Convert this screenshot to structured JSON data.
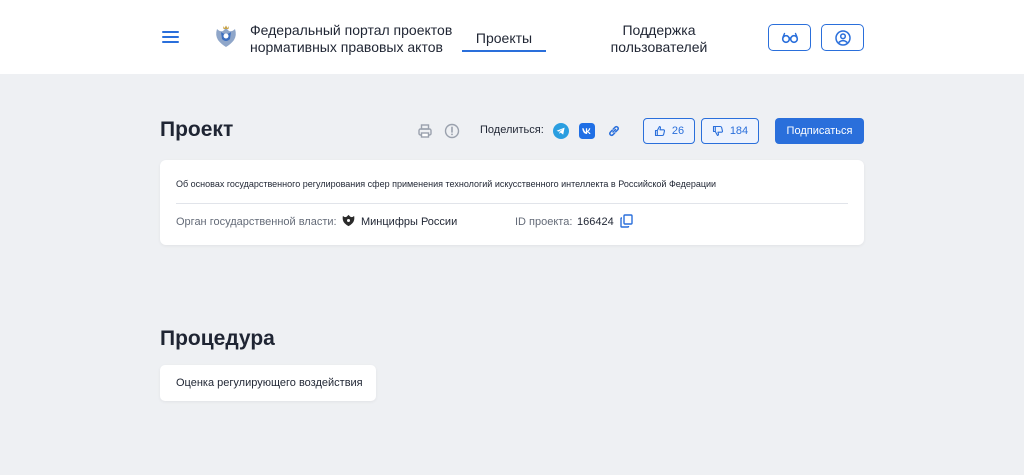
{
  "header": {
    "menu_icon": "hamburger-icon",
    "emblem_icon": "russian-coat-of-arms-icon",
    "portal_title_line1": "Федеральный портал проектов",
    "portal_title_line2": "нормативных правовых актов",
    "nav": {
      "projects": "Проекты",
      "support_line1": "Поддержка",
      "support_line2": "пользователей"
    },
    "buttons": {
      "accessibility_icon": "glasses-icon",
      "profile_icon": "user-icon"
    }
  },
  "project": {
    "heading": "Проект",
    "toolbar": {
      "print_icon": "printer-icon",
      "info_icon": "exclamation-circle-icon"
    },
    "share": {
      "label": "Поделиться:",
      "icons": [
        "telegram-icon",
        "vk-icon",
        "link-icon"
      ]
    },
    "likes": "26",
    "dislikes": "184",
    "subscribe_label": "Подписаться",
    "title": "Об основах государственного регулирования сфер применения технологий искусственного интеллекта в Российской Федерации",
    "org_label": "Орган государственной власти:",
    "org_value": "Минцифры России",
    "id_label": "ID проекта:",
    "id_value": "166424"
  },
  "procedure": {
    "heading": "Процедура",
    "stage": "Оценка регулирующего воздействия"
  },
  "colors": {
    "accent": "#2a6fdb",
    "background": "#eef0f3",
    "text": "#1f2533",
    "muted": "#646b78"
  }
}
